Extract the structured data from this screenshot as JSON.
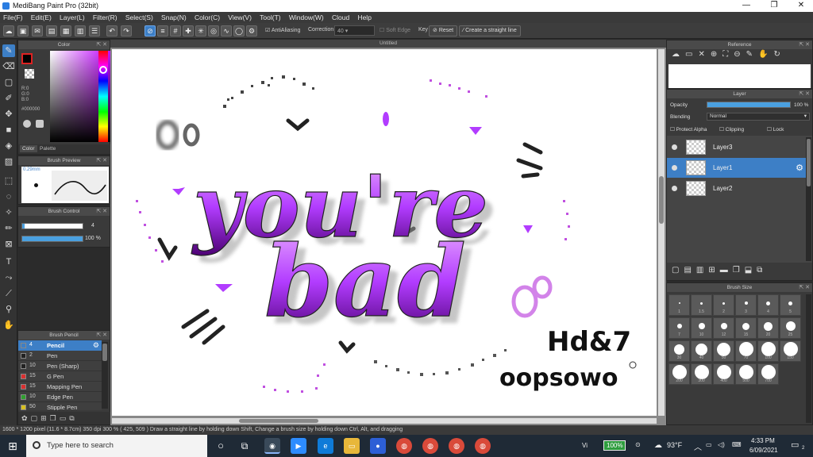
{
  "app": {
    "title": "MediBang Paint Pro (32bit)"
  },
  "window_controls": {
    "minimize": "—",
    "maximize": "❐",
    "close": "✕"
  },
  "menu": [
    "File(F)",
    "Edit(E)",
    "Layer(L)",
    "Filter(R)",
    "Select(S)",
    "Snap(N)",
    "Color(C)",
    "View(V)",
    "Tool(T)",
    "Window(W)",
    "Cloud",
    "Help"
  ],
  "toolbar": {
    "antialiasing_label": "AntiAliasing",
    "correction_label": "Correction",
    "correction_value": "40",
    "soft_edge_label": "Soft Edge",
    "key_label": "Key",
    "reset_label": "Reset",
    "straight_line_label": "Create a straight line"
  },
  "color_panel": {
    "title": "Color",
    "r": "R:0",
    "g": "G:0",
    "b": "B:0",
    "hex": "#000000",
    "tab_color": "Color",
    "tab_palette": "Palette"
  },
  "brush_preview": {
    "title": "Brush Preview",
    "size": "0.29mm"
  },
  "brush_control": {
    "title": "Brush Control",
    "size_value": "4",
    "opacity_value": "100 %",
    "opacity_fraction": 1.0
  },
  "brush_list": {
    "title": "Brush Pencil",
    "items": [
      {
        "size": "4",
        "name": "Pencil",
        "color": "#3d7fc6",
        "selected": true
      },
      {
        "size": "2",
        "name": "Pen",
        "color": "#222222"
      },
      {
        "size": "10",
        "name": "Pen (Sharp)",
        "color": "#222222"
      },
      {
        "size": "15",
        "name": "G Pen",
        "color": "#d93030"
      },
      {
        "size": "15",
        "name": "Mapping Pen",
        "color": "#d93030"
      },
      {
        "size": "10",
        "name": "Edge Pen",
        "color": "#2fa02f"
      },
      {
        "size": "50",
        "name": "Stipple Pen",
        "color": "#d8c020"
      }
    ]
  },
  "canvas": {
    "tab_title": "Untitled"
  },
  "reference_panel": {
    "title": "Reference"
  },
  "layer_panel": {
    "title": "Layer",
    "opacity_label": "Opacity",
    "opacity_value": "100 %",
    "opacity_fraction": 1.0,
    "blending_label": "Blending",
    "blending_value": "Normal",
    "protect_alpha": "Protect Alpha",
    "clipping": "Clipping",
    "lock": "Lock",
    "layers": [
      {
        "name": "Layer3",
        "selected": false
      },
      {
        "name": "Layer1",
        "selected": true
      },
      {
        "name": "Layer2",
        "selected": false
      }
    ]
  },
  "brush_size_panel": {
    "title": "Brush Size",
    "sizes": [
      "1",
      "1.5",
      "2",
      "3",
      "4",
      "5",
      "7",
      "10",
      "12",
      "15",
      "20",
      "25",
      "30",
      "40",
      "50",
      "70",
      "100",
      "150",
      "200",
      "300",
      "400",
      "500",
      "700"
    ]
  },
  "status": {
    "text": "1600 * 1200 pixel   (11.6 * 8.7cm)   350 dpi   300 %   ( 425, 509 )   Draw a straight line by holding down Shift, Change a brush size by holding down Ctrl, Alt, and dragging"
  },
  "taskbar": {
    "search_placeholder": "Type here to search",
    "battery": "100%",
    "weather": "93°F",
    "time": "4:33 PM",
    "date": "6/09/2021",
    "notifications": "2"
  },
  "artwork": {
    "line1": "you're",
    "line2": "bad",
    "signature1": "Hd&7",
    "signature2": "oopsowo",
    "accent": "#b23cff"
  }
}
